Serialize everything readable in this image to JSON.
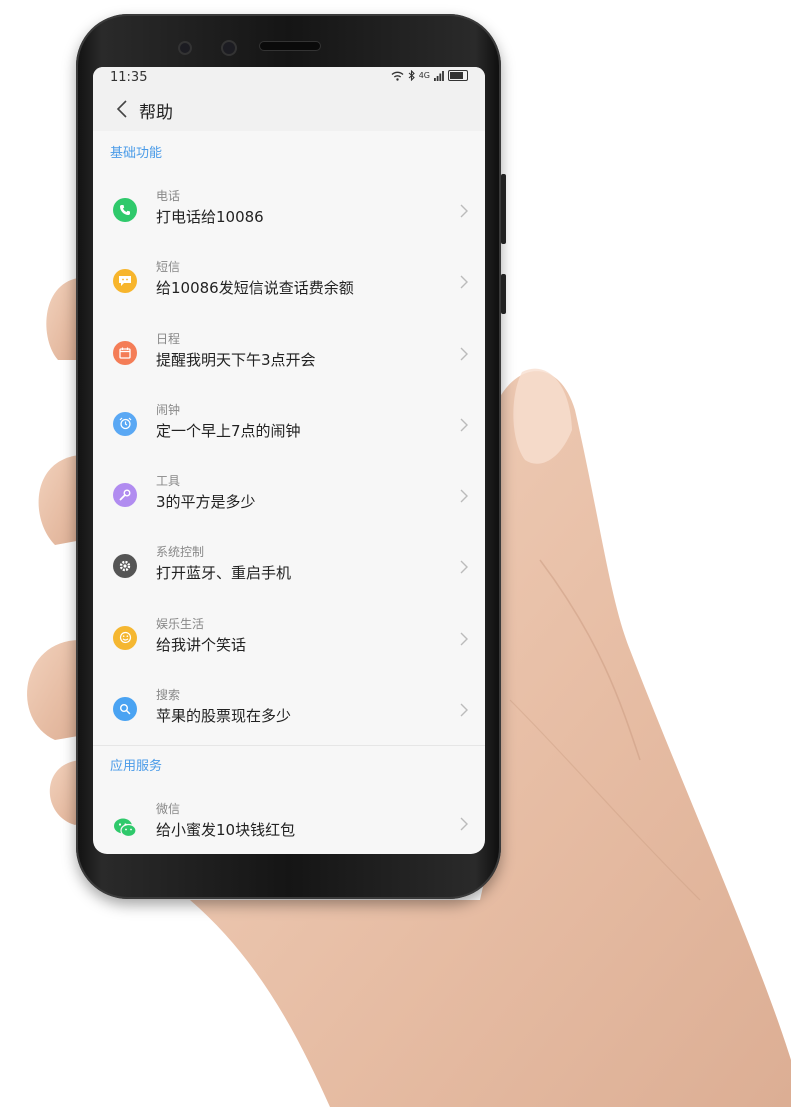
{
  "status": {
    "time": "11:35",
    "signal": "4G"
  },
  "header": {
    "title": "帮助"
  },
  "sections": [
    {
      "title": "基础功能",
      "items": [
        {
          "category": "电话",
          "example": "打电话给10086",
          "icon": "phone-icon",
          "color": "#2fc96b"
        },
        {
          "category": "短信",
          "example": "给10086发短信说查话费余额",
          "icon": "message-icon",
          "color": "#f7b52c"
        },
        {
          "category": "日程",
          "example": "提醒我明天下午3点开会",
          "icon": "calendar-icon",
          "color": "#f47d57"
        },
        {
          "category": "闹钟",
          "example": "定一个早上7点的闹钟",
          "icon": "alarm-icon",
          "color": "#5aa8f4"
        },
        {
          "category": "工具",
          "example": "3的平方是多少",
          "icon": "wrench-icon",
          "color": "#b18cf0"
        },
        {
          "category": "系统控制",
          "example": "打开蓝牙、重启手机",
          "icon": "gear-icon",
          "color": "#555555"
        },
        {
          "category": "娱乐生活",
          "example": "给我讲个笑话",
          "icon": "smile-icon",
          "color": "#f5b731"
        },
        {
          "category": "搜索",
          "example": "苹果的股票现在多少",
          "icon": "search-icon",
          "color": "#4aa3f2"
        }
      ]
    },
    {
      "title": "应用服务",
      "items": [
        {
          "category": "微信",
          "example": "给小蜜发10块钱红包",
          "icon": "wechat-icon",
          "color": "#2fc96b"
        }
      ]
    }
  ]
}
